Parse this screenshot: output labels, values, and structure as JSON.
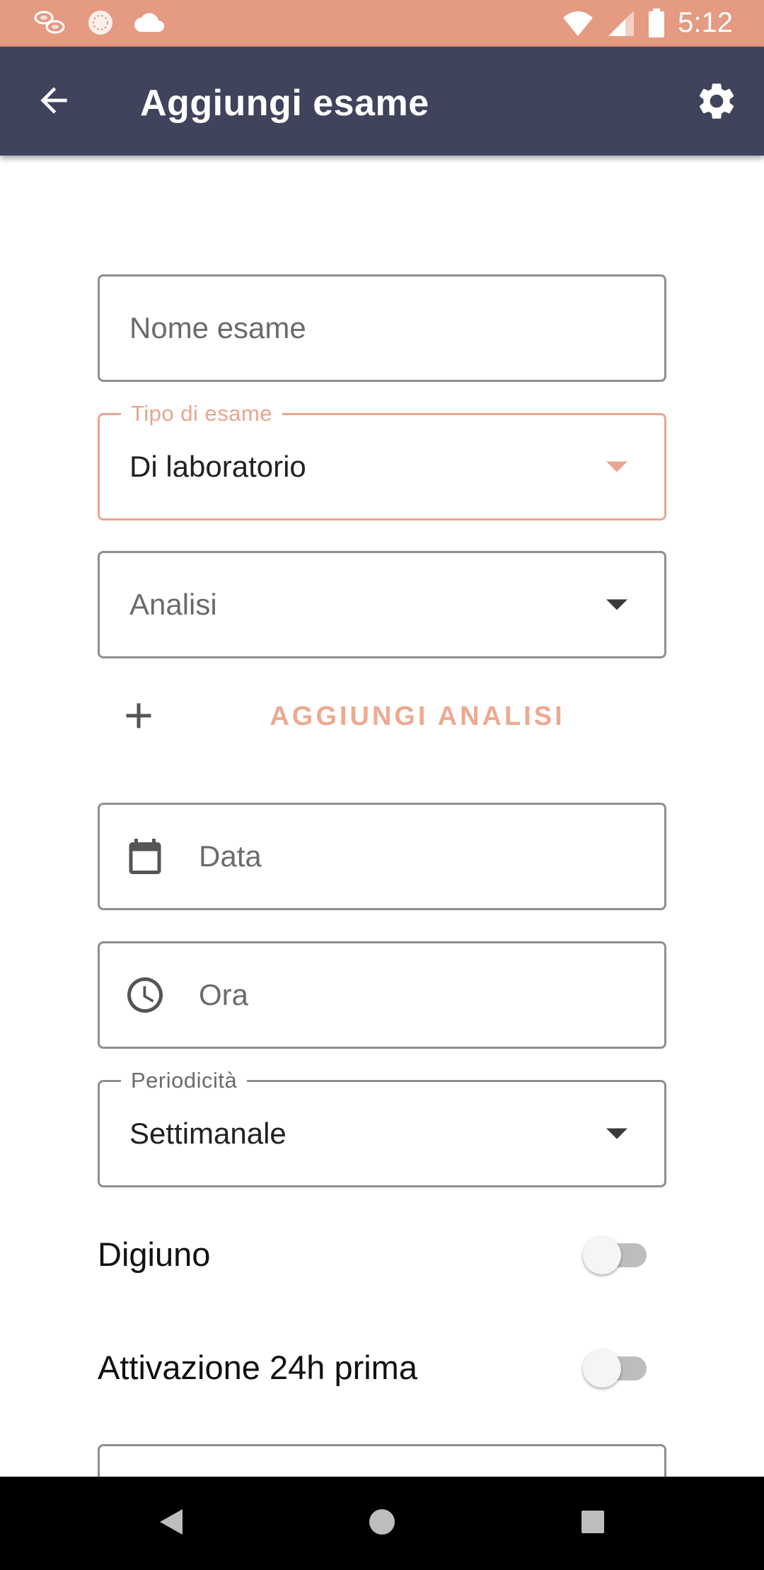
{
  "status_bar": {
    "time": "5:12",
    "left_icons": [
      "blood-cells-icon",
      "pill-icon",
      "cloud-icon"
    ],
    "right_icons": [
      "wifi-icon",
      "signal-icon",
      "battery-icon"
    ],
    "background": "#E59A82"
  },
  "app_bar": {
    "title": "Aggiungi esame",
    "background": "#3F435B"
  },
  "form": {
    "nome_esame": {
      "placeholder": "Nome esame",
      "value": ""
    },
    "tipo_esame": {
      "label": "Tipo di esame",
      "value": "Di laboratorio"
    },
    "analisi": {
      "placeholder": "Analisi"
    },
    "add_analisi_label": "AGGIUNGI ANALISI",
    "data": {
      "placeholder": "Data"
    },
    "ora": {
      "placeholder": "Ora"
    },
    "periodicita": {
      "label": "Periodicità",
      "value": "Settimanale"
    },
    "digiuno": {
      "label": "Digiuno",
      "checked": false
    },
    "attivazione": {
      "label": "Attivazione 24h prima",
      "checked": false
    }
  },
  "colors": {
    "accent": "#E9A58E",
    "border": "#8E8E8E"
  }
}
